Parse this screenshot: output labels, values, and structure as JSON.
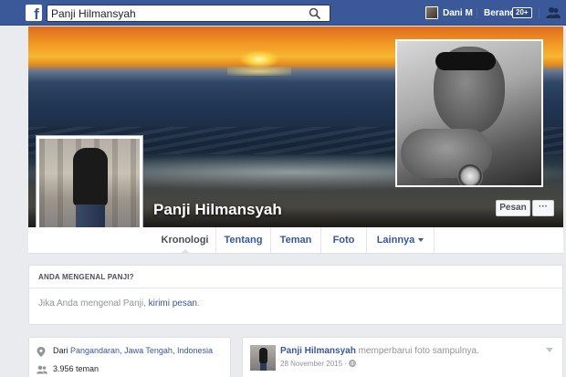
{
  "topbar": {
    "logo": "f",
    "search_value": "Panji Hilmansyah",
    "user_name": "Dani M",
    "home_label": "Beranda",
    "home_badge": "20+"
  },
  "profile": {
    "name": "Panji Hilmansyah",
    "message_button": "Pesan",
    "more_button": "···"
  },
  "tabs": [
    {
      "label": "Kronologi",
      "active": true
    },
    {
      "label": "Tentang",
      "active": false
    },
    {
      "label": "Teman",
      "active": false
    },
    {
      "label": "Foto",
      "active": false
    },
    {
      "label": "Lainnya",
      "active": false
    }
  ],
  "know_card": {
    "title": "ANDA MENGENAL PANJI?",
    "text_prefix": "Jika Anda mengenal Panji, ",
    "link": "kirimi pesan",
    "text_suffix": "."
  },
  "intro": {
    "from_prefix": "Dari ",
    "from_place": "Pangandaran, Jawa Tengah, Indonesia",
    "friends": "3.956 teman"
  },
  "post": {
    "author": "Panji Hilmansyah",
    "action": " memperbarui foto sampulnya.",
    "date": "28 November 2015 ·"
  },
  "colors": {
    "topbar": "#3b5998",
    "link": "#365899",
    "page_bg": "#e9ebee"
  },
  "icons": [
    "facebook-logo-icon",
    "search-icon",
    "friends-icon",
    "location-pin-icon",
    "people-icon",
    "globe-icon",
    "chevron-down-icon"
  ]
}
